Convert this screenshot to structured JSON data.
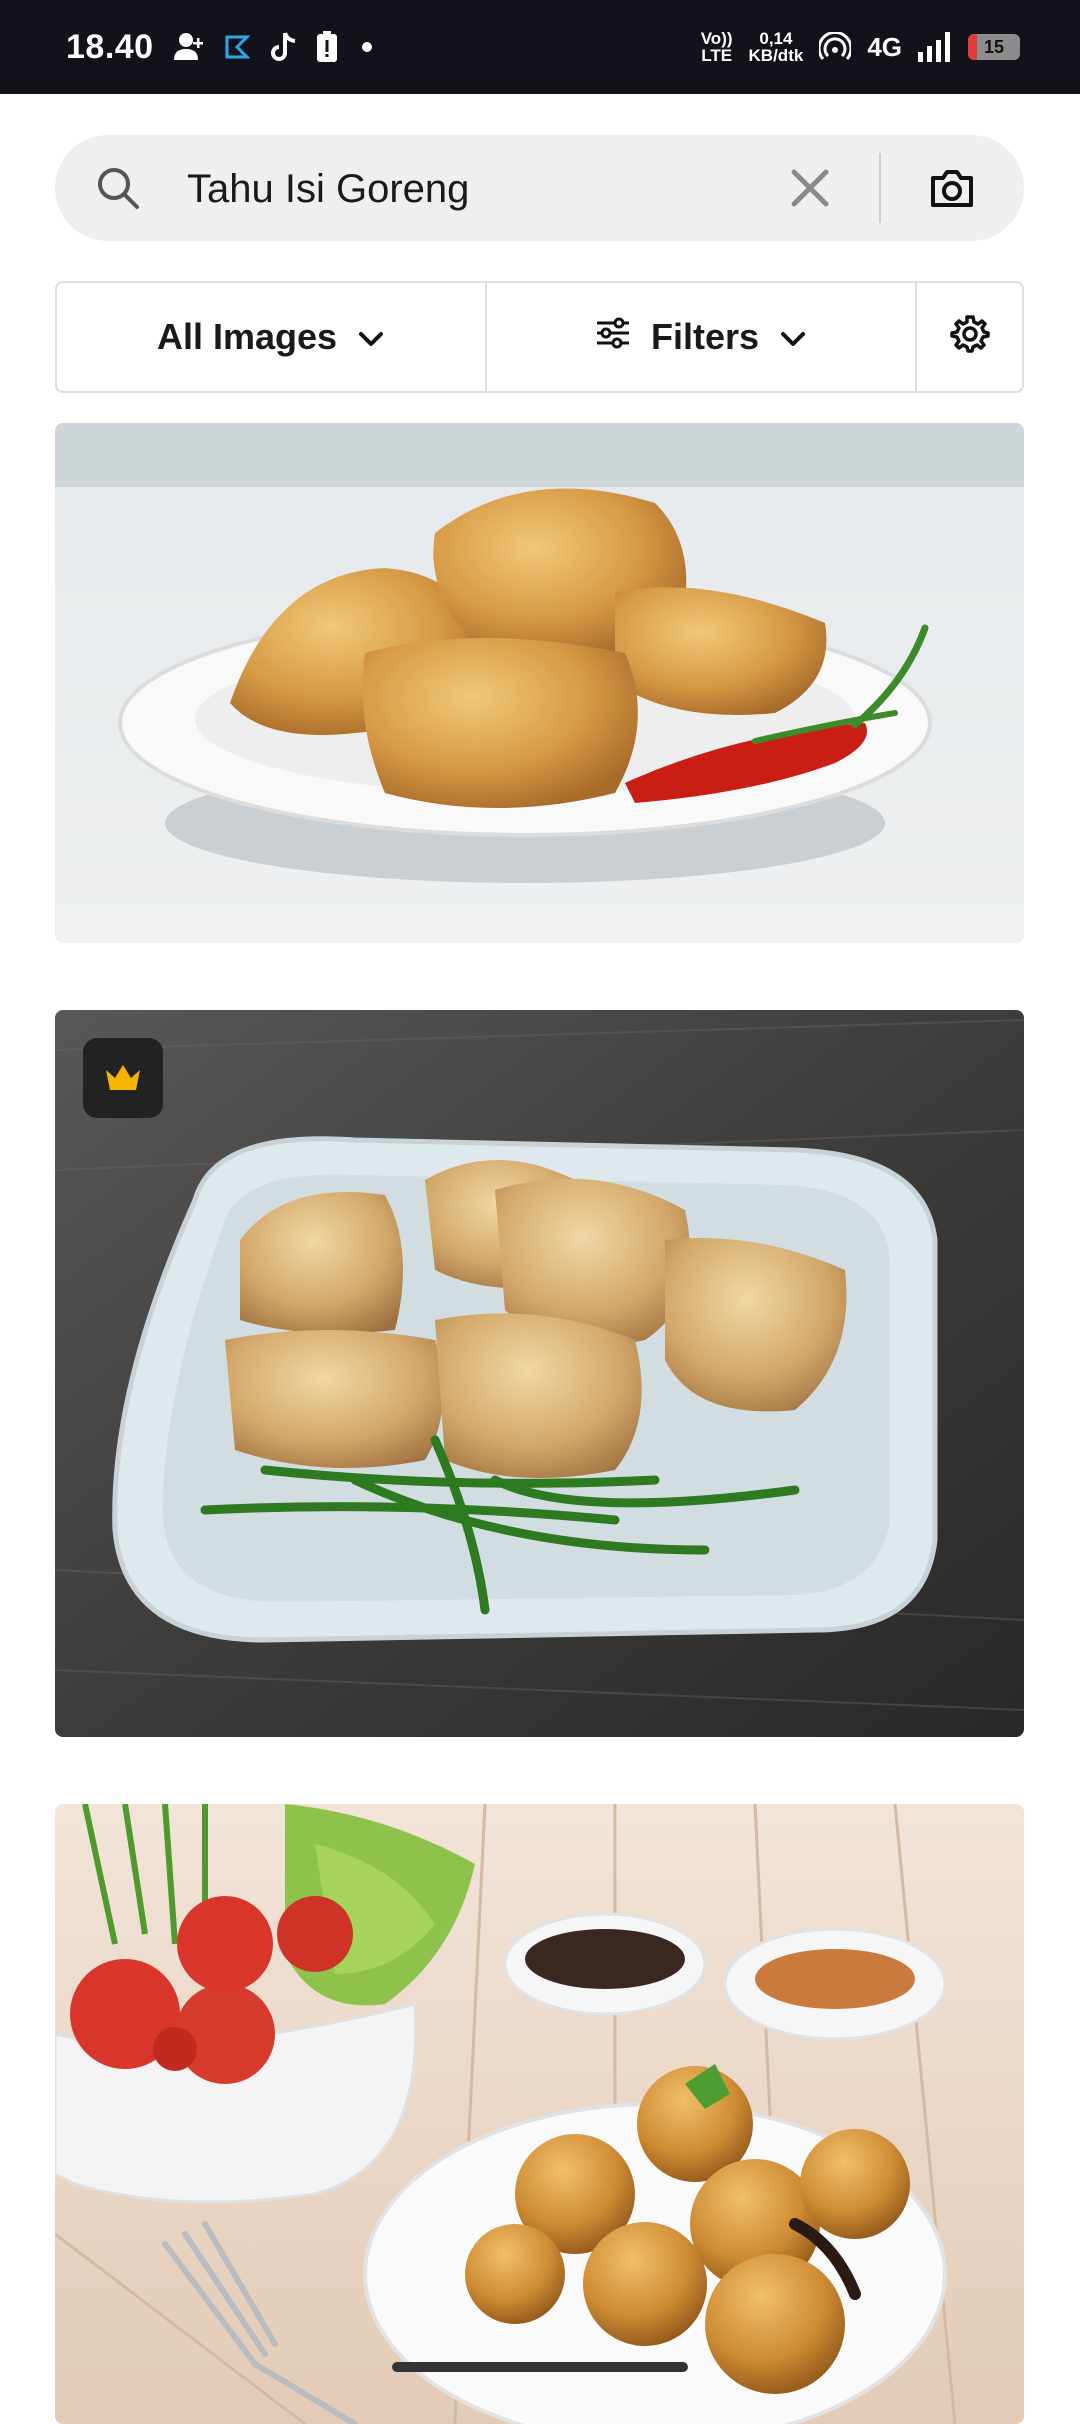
{
  "status_bar": {
    "time": "18.40",
    "network_label_top": "Vo))",
    "network_label_bottom": "LTE",
    "speed_value": "0,14",
    "speed_unit": "KB/dtk",
    "network_type": "4G",
    "battery_level": "15",
    "icons": [
      "add-person-icon",
      "app-icon",
      "tiktok-icon",
      "battery-alert-icon",
      "dot-icon",
      "hotspot-icon",
      "signal-icon",
      "battery-icon"
    ]
  },
  "search": {
    "query": "Tahu Isi Goreng",
    "icons": [
      "search-icon",
      "close-icon",
      "camera-icon"
    ]
  },
  "filters": {
    "all_images_label": "All Images",
    "filters_label": "Filters",
    "icons": [
      "chevron-down-icon",
      "sliders-icon",
      "gear-icon"
    ]
  },
  "results": [
    {
      "premium": false
    },
    {
      "premium": true,
      "badge_icon": "crown-icon"
    },
    {
      "premium": false
    }
  ],
  "colors": {
    "status_bar_bg": "#12131a",
    "search_bg": "#efefef",
    "crown": "#f5b400",
    "battery_low": "#e03a3a"
  }
}
